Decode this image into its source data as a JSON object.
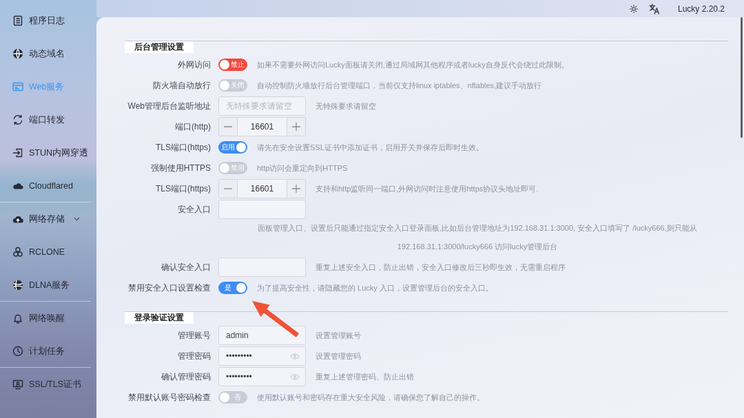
{
  "topbar": {
    "version": "Lucky 2.20.2"
  },
  "sidebar": {
    "groups": [
      {
        "items": [
          {
            "label": "程序日志",
            "selected": false
          },
          {
            "label": "动态域名",
            "selected": false
          },
          {
            "label": "Web服务",
            "selected": true
          },
          {
            "label": "端口转发",
            "selected": false
          },
          {
            "label": "STUN内网穿透",
            "selected": false
          },
          {
            "label": "Cloudflared",
            "selected": false
          }
        ]
      },
      {
        "items": [
          {
            "label": "网络存储",
            "selected": false,
            "expanded": false
          },
          {
            "label": "RCLONE",
            "selected": false
          },
          {
            "label": "DLNA服务",
            "selected": false
          }
        ]
      },
      {
        "items": [
          {
            "label": "网络唤醒",
            "selected": false
          },
          {
            "label": "计划任务",
            "selected": false
          }
        ]
      },
      {
        "items": [
          {
            "label": "SSL/TLS证书",
            "selected": false
          }
        ]
      }
    ]
  },
  "sections": [
    {
      "title": "后台管理设置",
      "rows": [
        {
          "kind": "switch",
          "label": "外网访问",
          "on": false,
          "color": "#f5483b",
          "text": "禁止",
          "help": "如果不需要外网访问Lucky面板请关闭,通过局域网其他程序或者lucky自身反代会绕过此限制。"
        },
        {
          "kind": "switch",
          "label": "防火墙自动放行",
          "on": false,
          "color": "#c9ccd5",
          "text": "关闭",
          "help": "自动控制防火墙放行后台管理端口，当前仅支持linux iptables、nftables,建议手动放行"
        },
        {
          "kind": "input",
          "label": "Web管理后台监听地址",
          "placeholder": "无特殊要求请留空",
          "help": "无特殊要求请留空"
        },
        {
          "kind": "stepper",
          "label": "端口(http)",
          "value": "16601"
        },
        {
          "kind": "switch",
          "label": "TLS端口(https)",
          "on": true,
          "color": "#3d8ef5",
          "text": "启用",
          "help": "请先在安全设置SSL证书中添加证书，启用开关并保存后即时生效。"
        },
        {
          "kind": "switch",
          "label": "强制使用HTTPS",
          "on": false,
          "color": "#c9ccd5",
          "text": "禁用",
          "help": "http访问会重定向到HTTPS"
        },
        {
          "kind": "stepper",
          "label": "TLS端口(https)",
          "value": "16601",
          "help": "支持和http监听同一端口,外网访问时注意使用https协议头地址即可."
        },
        {
          "kind": "input",
          "label": "安全入口",
          "note_lines": [
            "面板管理入口、设置后只能通过指定安全入口登录面板,比如后台管理地址为192.168.31.1:3000, 安全入口填写了 /lucky666,则只能从",
            "192.168.31.1:3000/lucky666 访问lucky管理后台"
          ]
        },
        {
          "kind": "input",
          "label": "确认安全入口",
          "help": "重复上述安全入口，防止出错，安全入口修改后三秒即生效，无需重启程序"
        },
        {
          "kind": "switch",
          "label": "禁用安全入口设置检查",
          "on": true,
          "color": "#3d8ef5",
          "text": "是",
          "help": "为了提高安全性，请隐藏您的 Lucky 入口，设置管理后台的安全入口。"
        }
      ]
    },
    {
      "title": "登录验证设置",
      "rows": [
        {
          "kind": "input",
          "label": "管理账号",
          "value": "admin",
          "help": "设置管理账号"
        },
        {
          "kind": "password",
          "label": "管理密码",
          "value": "•••••••••",
          "help": "设置管理密码"
        },
        {
          "kind": "password",
          "label": "确认管理密码",
          "value": "•••••••••",
          "help": "重复上述管理密码、防止出错"
        },
        {
          "kind": "switch",
          "label": "禁用默认账号密码检查",
          "on": false,
          "color": "#c9ccd5",
          "text": "否",
          "help": "使用默认账号和密码存在重大安全风险，请确保您了解自己的操作。"
        }
      ]
    }
  ]
}
